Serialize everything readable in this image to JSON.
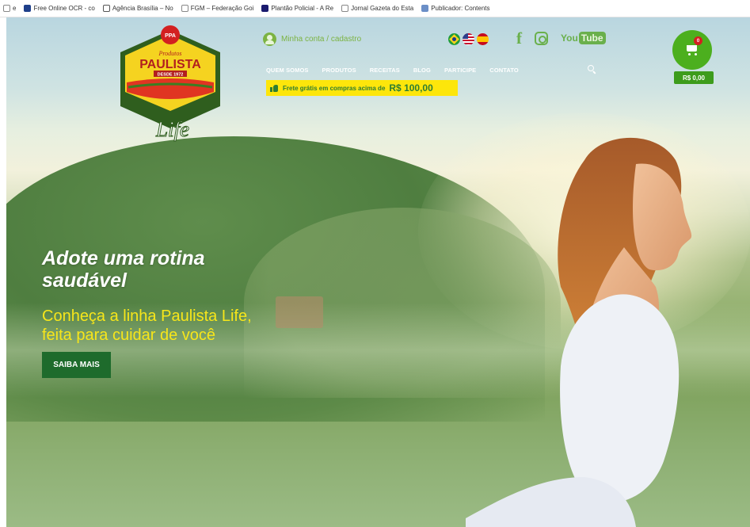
{
  "bookmarks": [
    {
      "label": "e",
      "icon": "page-icon"
    },
    {
      "label": "Free Online OCR - co",
      "icon": "ocr-icon"
    },
    {
      "label": "Agência Brasília – No",
      "icon": "agencia-icon"
    },
    {
      "label": "FGM – Federação Goi",
      "icon": "document-icon"
    },
    {
      "label": "Plantão Policial - A Re",
      "icon": "plantao-icon"
    },
    {
      "label": "Jornal Gazeta do Esta",
      "icon": "document-icon"
    },
    {
      "label": "Publicador: Contents",
      "icon": "publicador-icon"
    }
  ],
  "header": {
    "logo": {
      "top_text": "Produtos",
      "brand": "PAULISTA",
      "since": "DESDE 1972",
      "badge": "PPA",
      "sub_brand": "Life"
    },
    "account_label": "Minha conta / cadastro",
    "languages": [
      "pt-BR",
      "en-US",
      "es-ES"
    ],
    "social": {
      "facebook": "f",
      "youtube_you": "You",
      "youtube_tube": "Tube"
    },
    "nav": [
      "QUEM SOMOS",
      "PRODUTOS",
      "RECEITAS",
      "BLOG",
      "PARTICIPE",
      "CONTATO"
    ],
    "shipping_text": "Frete grátis em compras acima de",
    "shipping_amount": "R$ 100,00",
    "cart": {
      "count": "0",
      "total": "R$ 0,00"
    }
  },
  "hero": {
    "headline_line1": "Adote uma rotina",
    "headline_line2": "saudável",
    "sub_line1": "Conheça a linha Paulista Life,",
    "sub_line2": "feita para cuidar de você",
    "cta_label": "SAIBA MAIS"
  },
  "colors": {
    "brand_green": "#4caf1e",
    "dark_green": "#1e6b2c",
    "accent_yellow": "#fde60b",
    "logo_red": "#d32020"
  }
}
